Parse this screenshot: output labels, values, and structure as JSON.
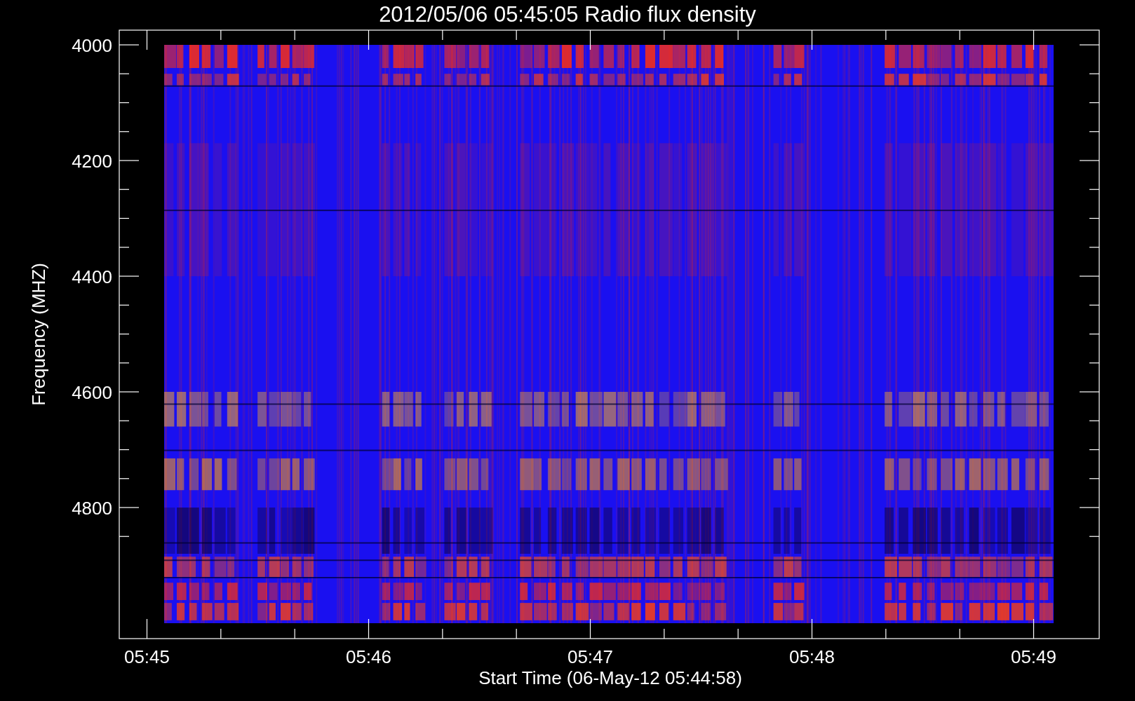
{
  "title": "2012/05/06 05:45:05 Radio flux density",
  "y_axis": {
    "label": "Frequency (MHZ)",
    "tick_labels": [
      "4000",
      "4200",
      "4400",
      "4600",
      "4800"
    ]
  },
  "x_axis": {
    "label": "Start Time (06-May-12 05:44:58)",
    "tick_labels": [
      "05:45",
      "05:46",
      "05:47",
      "05:48",
      "05:49"
    ]
  }
}
